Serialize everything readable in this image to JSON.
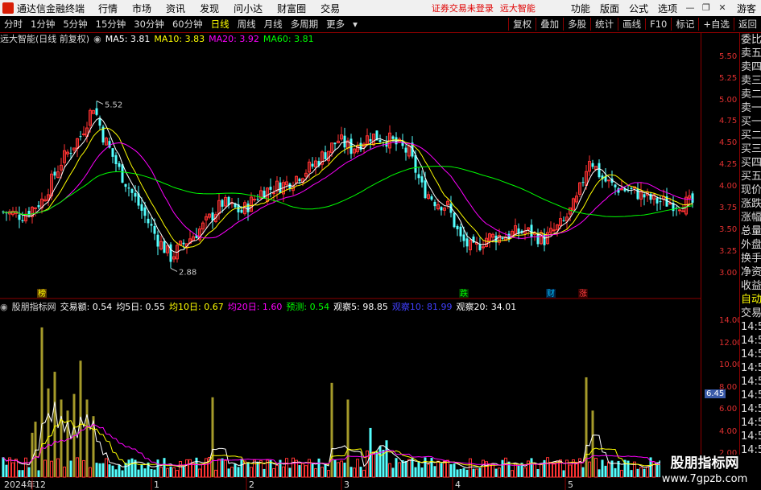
{
  "app": {
    "title": "通达信金融终端"
  },
  "menu": [
    "行情",
    "市场",
    "资讯",
    "发现",
    "问小达",
    "财富圈",
    "交易"
  ],
  "menu_status": [
    "证券交易未登录",
    "远大智能"
  ],
  "menu_right": [
    "功能",
    "版面",
    "公式",
    "选项"
  ],
  "guest_label": "游客",
  "toolbar": {
    "periods": [
      "分时",
      "1分钟",
      "5分钟",
      "15分钟",
      "30分钟",
      "60分钟",
      "日线",
      "周线",
      "月线",
      "多周期",
      "更多"
    ],
    "active": "日线",
    "right": [
      "复权",
      "叠加",
      "多股",
      "统计",
      "画线",
      "F10",
      "标记",
      "+自选",
      "返回"
    ]
  },
  "price_panel": {
    "stock_label": "远大智能(日线 前复权)",
    "ma": [
      {
        "label": "MA5: 3.81",
        "color": "#ffffff"
      },
      {
        "label": "MA10: 3.83",
        "color": "#ffff00"
      },
      {
        "label": "MA20: 3.92",
        "color": "#ff00ff"
      },
      {
        "label": "MA60: 3.81",
        "color": "#00ff00"
      }
    ],
    "high_label": "5.52",
    "low_label": "2.88",
    "markers": [
      {
        "text": "榜",
        "color": "#ffff00",
        "bg": "#5a3a00"
      },
      {
        "text": "跌",
        "color": "#00ff00",
        "bg": "#003300"
      },
      {
        "text": "财",
        "color": "#00c0ff",
        "bg": "#002244"
      },
      {
        "text": "涨",
        "color": "#ff4040",
        "bg": "#330000"
      }
    ],
    "y_ticks": [
      "5.50",
      "5.25",
      "5.00",
      "4.75",
      "4.50",
      "4.25",
      "4.00",
      "3.75",
      "3.50",
      "3.25",
      "3.00"
    ]
  },
  "volume_panel": {
    "indicator_name": "股朋指标网",
    "items": [
      {
        "label": "交易额: 0.54",
        "color": "#ffffff"
      },
      {
        "label": "均5日: 0.55",
        "color": "#ffffff"
      },
      {
        "label": "均10日: 0.67",
        "color": "#ffff00"
      },
      {
        "label": "均20日: 1.60",
        "color": "#ff00ff"
      },
      {
        "label": "预测: 0.54",
        "color": "#00ff00"
      },
      {
        "label": "观察5: 98.85",
        "color": "#ffffff"
      },
      {
        "label": "观察10: 81.99",
        "color": "#4040ff"
      },
      {
        "label": "观察20: 34.01",
        "color": "#ffffff"
      }
    ],
    "y_ticks": [
      "14.00",
      "12.00",
      "10.00",
      "8.00",
      "6.00",
      "4.00",
      "2.00"
    ],
    "current_value": "6.45"
  },
  "x_axis": {
    "labels": [
      "2024年",
      "12",
      "1",
      "2",
      "3",
      "4",
      "5"
    ]
  },
  "right_panel": [
    "委比",
    "卖五",
    "卖四",
    "卖三",
    "卖二",
    "卖一",
    "买一",
    "买二",
    "买三",
    "买四",
    "买五",
    "现价",
    "涨跌",
    "涨幅",
    "总量",
    "外盘",
    "换手",
    "净资",
    "收益",
    "自动",
    "交易",
    "14:5",
    "14:5",
    "14:5",
    "14:5",
    "14:5",
    "14:5",
    "14:5",
    "14:5",
    "14:5",
    "14:5"
  ],
  "watermark": {
    "line1": "股朋指标网",
    "line2": "www.7gpzb.com"
  },
  "colors": {
    "up": "#ff3232",
    "down": "#54ffff",
    "volume_highlight": "#a59a2a",
    "border": "#8b0000"
  }
}
